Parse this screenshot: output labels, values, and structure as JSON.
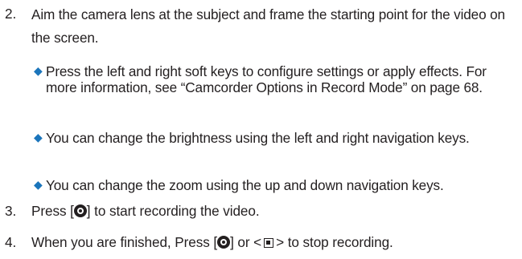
{
  "steps": {
    "step2": {
      "number": "2.",
      "text": "Aim the camera lens at the subject and frame the starting point for the video on the screen.",
      "bullets": [
        {
          "text": "Press the left and right soft keys to configure settings or apply effects. For more information, see “Camcorder Options in Record Mode” on page 68."
        },
        {
          "text": "You can change the brightness using the left and right navigation keys."
        },
        {
          "text": "You can change the zoom using the up and down navigation keys."
        }
      ]
    },
    "step3": {
      "number": "3.",
      "before": "Press [",
      "after": "] to start recording the video.",
      "icon": "ok-key-icon"
    },
    "step4": {
      "number": "4.",
      "before": "When you are finished, Press [",
      "middle": "] or <",
      "after": "> to stop recording.",
      "icons": [
        "ok-key-icon",
        "soft-key-icon"
      ]
    }
  },
  "colors": {
    "text": "#231f20",
    "bullet": "#1b75bb"
  }
}
